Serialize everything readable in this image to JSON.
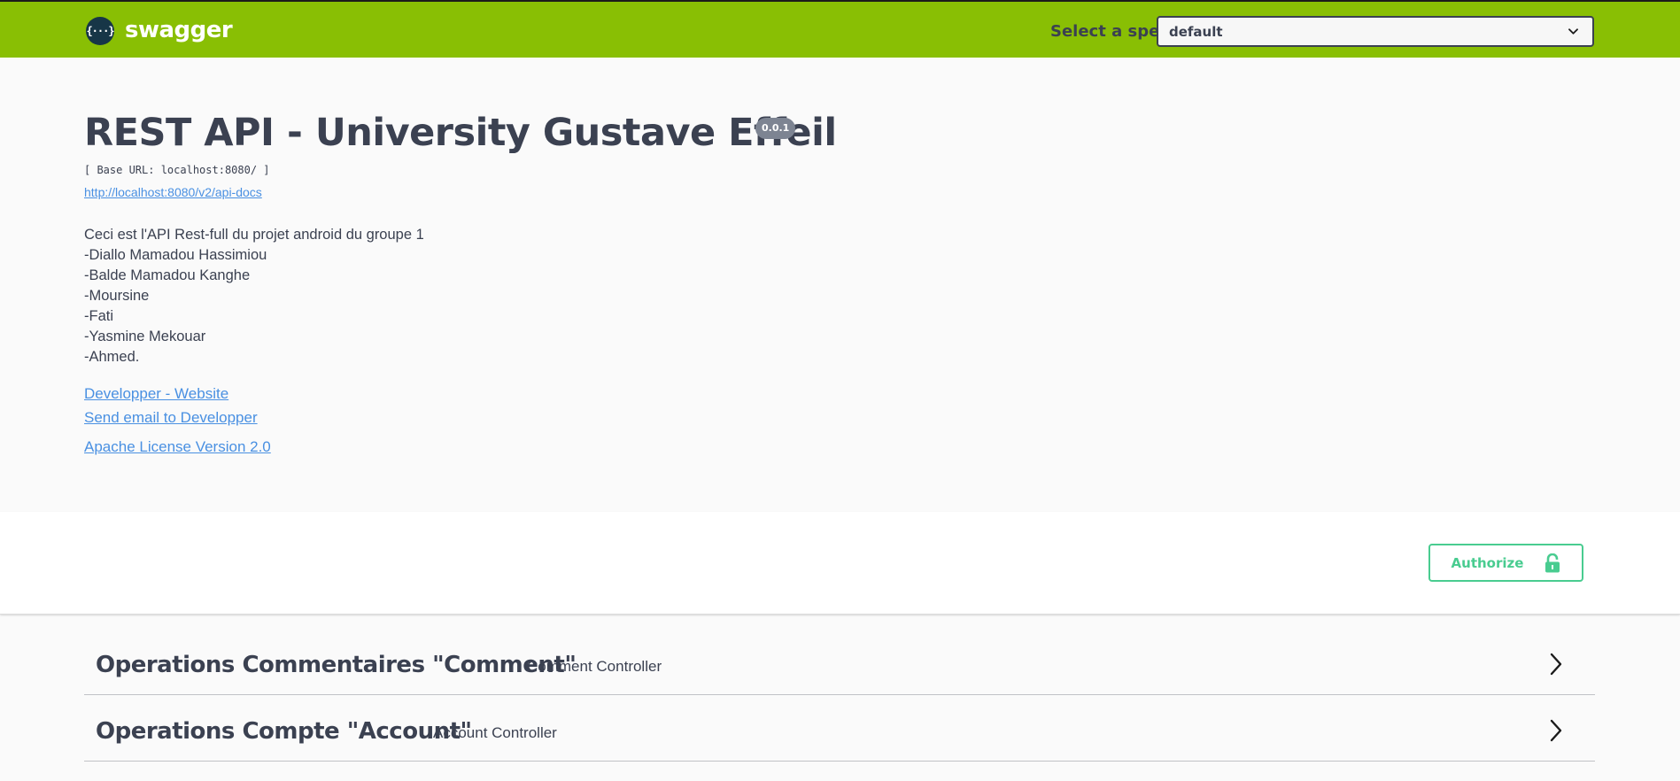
{
  "topbar": {
    "logo_glyph": "{···}",
    "logo_text": "swagger",
    "spec_label": "Select a spec",
    "spec_value": "default",
    "bg_color": "#89bf04"
  },
  "info": {
    "title": "REST API - University Gustave Effeil",
    "version": "0.0.1",
    "base_url": "[ Base URL: localhost:8080/ ]",
    "docs_url": "http://localhost:8080/v2/api-docs",
    "description": [
      "Ceci est l'API Rest-full du projet android du groupe 1",
      "-Diallo Mamadou Hassimiou",
      "-Balde Mamadou Kanghe",
      "-Moursine",
      "-Fati",
      "-Yasmine Mekouar",
      "-Ahmed."
    ],
    "website_link": "Developper - Website",
    "email_link": "Send email to Developper",
    "license_link": "Apache License Version 2.0"
  },
  "authorize": {
    "label": "Authorize",
    "icon": "lock-icon",
    "color": "#49cc90"
  },
  "tags": [
    {
      "name": "Operations Commentaires \"Comment\"",
      "description": "Comment Controller"
    },
    {
      "name": "Operations Compte \"Account\"",
      "description": "Account Controller"
    }
  ]
}
